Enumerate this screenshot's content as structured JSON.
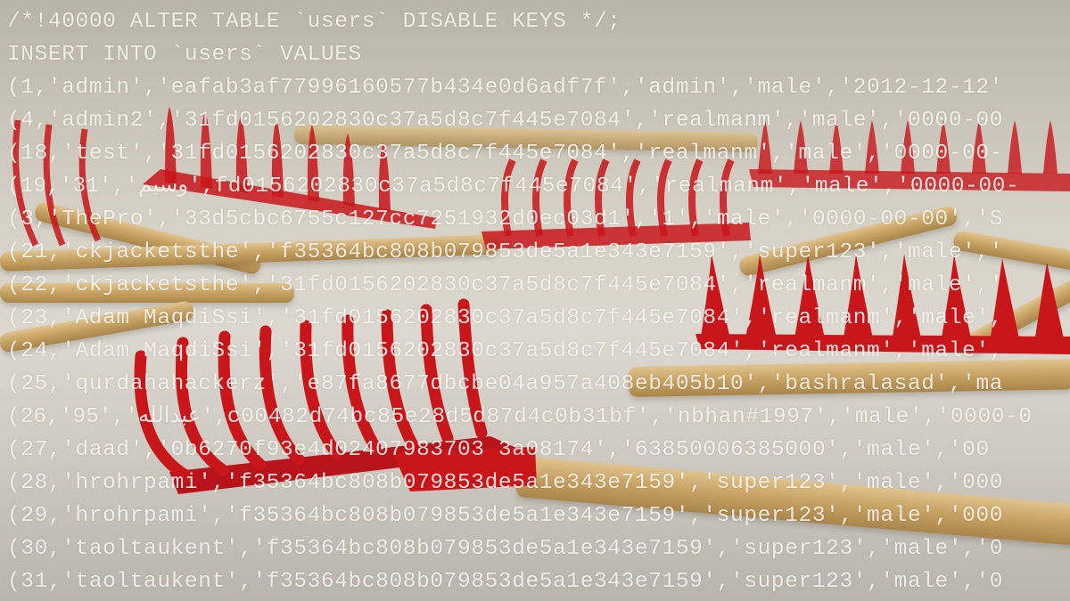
{
  "image": {
    "subject": "photo of red garden rakes with wooden handles overlaid with SQL dump text",
    "colors": {
      "rake_red": "#c8161b",
      "handle_wood": "#c9a466",
      "background": "#d7d2c7",
      "text": "#f6f4ee"
    }
  },
  "sql_lines": [
    "/*!40000 ALTER TABLE `users` DISABLE KEYS */;",
    "INSERT INTO `users` VALUES",
    "(1,'admin','eafab3af77996160577b434e0d6adf7f','admin','male','2012-12-12'",
    "(4,'admin2','31fd0156202830c37a5d8c7f445e7084','realmanm','male','0000-00",
    "(18,'test','31fd0156202830c37a5d8c7f445e7084','realmanm','male','0000-00-",
    "(19,'31','وسيم',fd0156202830c37a5d8c7f445e7084','realmanm','male','0000-00-",
    "(3,'ThePro','33d5cbc6755c127cc7251932d0ec03d1','1','male','0000-00-00','S",
    "(21,'ckjacketsthe','f35364bc808b079853de5a1e343e7159','super123','male','",
    "(22,'ckjacketsthe','31fd0156202830c37a5d8c7f445e7084','realmanm','male','",
    "(23,'Adam MaqdiSsi','31fd0156202830c37a5d8c7f445e7084','realmanm','male',",
    "(24,'Adam MaqdiSsi','31fd0156202830c37a5d8c7f445e7084','realmanm','male',",
    "(25,'qurdahahackerz','e87fa8677dbcbe04a957a408eb405b10','bashralasad','ma",
    "(26,'95','عبدالله',c00482d74bc85e28d5d87d4c0b31bf','nbhan#1997','male','0000-0",
    "(27,'daad','0b6270f93e4d02407983703 3a08174','63850006385000','male','00",
    "(28,'hrohrpami','f35364bc808b079853de5a1e343e7159','super123','male','000",
    "(29,'hrohrpami','f35364bc808b079853de5a1e343e7159','super123','male','000",
    "(30,'taoltaukent','f35364bc808b079853de5a1e343e7159','super123','male','0",
    "(31,'taoltaukent','f35364bc808b079853de5a1e343e7159','super123','male','0"
  ]
}
